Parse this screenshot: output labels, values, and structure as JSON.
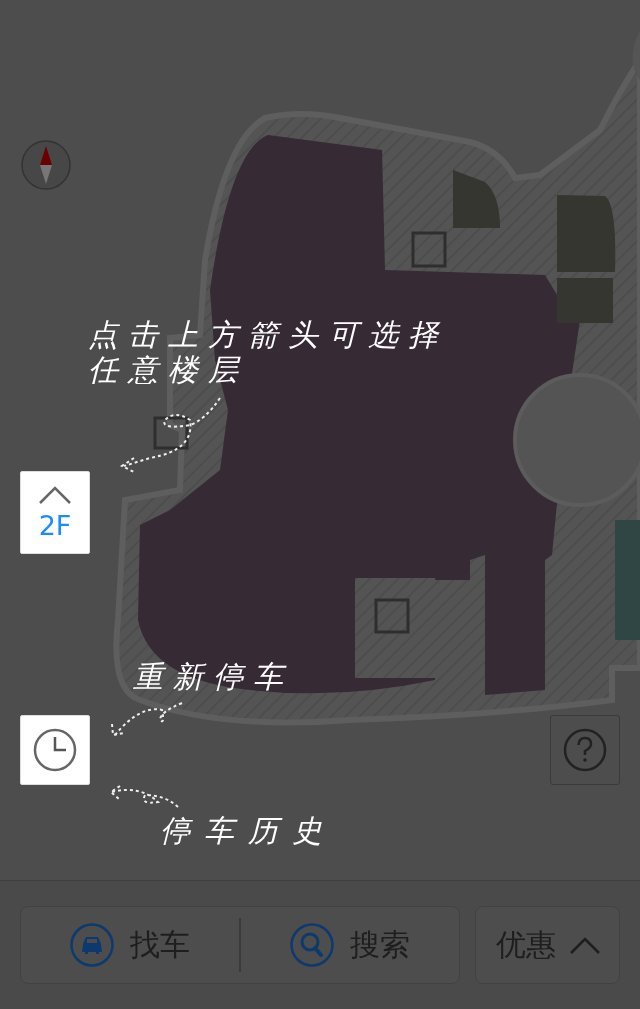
{
  "hints": [
    "点击上方箭头可选择任意楼层",
    "重新停车",
    "停车历史"
  ],
  "floor_selector": {
    "label": "2F"
  },
  "bottom_bar": {
    "segments": [
      {
        "kind": "car",
        "label": "找车"
      },
      {
        "kind": "search",
        "label": "搜索"
      }
    ],
    "deals": {
      "label": "优惠"
    }
  }
}
